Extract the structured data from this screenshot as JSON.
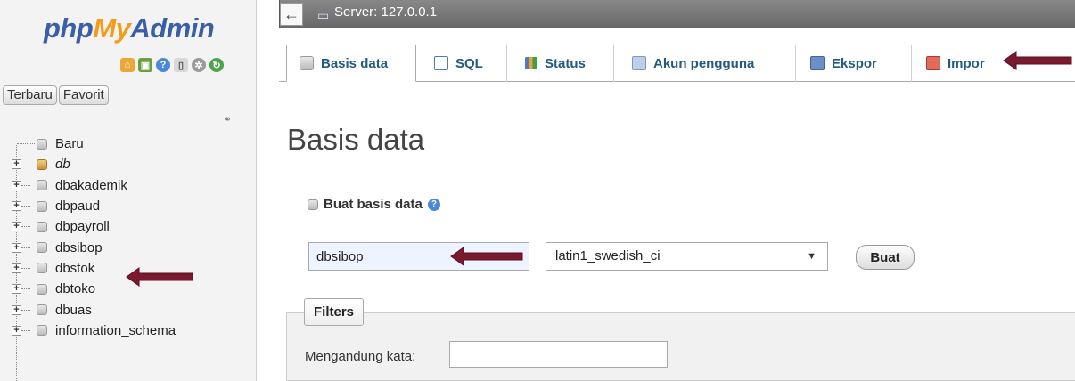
{
  "app": {
    "logo_part1": "php",
    "logo_part2": "My",
    "logo_part3": "Admin"
  },
  "sidebar": {
    "tabs": [
      "Terbaru",
      "Favorit"
    ],
    "toolbar_icons": [
      "home-icon",
      "exit-icon",
      "help-icon",
      "docs-icon",
      "settings-icon",
      "reload-icon"
    ],
    "tree": [
      {
        "label": "Baru",
        "icon": "new-db-icon",
        "expandable": false,
        "italic": false
      },
      {
        "label": "db",
        "icon": "db-group-icon",
        "expandable": true,
        "italic": true
      },
      {
        "label": "dbakademik",
        "icon": "database-icon",
        "expandable": true,
        "italic": false
      },
      {
        "label": "dbpaud",
        "icon": "database-icon",
        "expandable": true,
        "italic": false
      },
      {
        "label": "dbpayroll",
        "icon": "database-icon",
        "expandable": true,
        "italic": false
      },
      {
        "label": "dbsibop",
        "icon": "database-icon",
        "expandable": true,
        "italic": false
      },
      {
        "label": "dbstok",
        "icon": "database-icon",
        "expandable": true,
        "italic": false
      },
      {
        "label": "dbtoko",
        "icon": "database-icon",
        "expandable": true,
        "italic": false
      },
      {
        "label": "dbuas",
        "icon": "database-icon",
        "expandable": true,
        "italic": false
      },
      {
        "label": "information_schema",
        "icon": "database-icon",
        "expandable": true,
        "italic": false
      }
    ]
  },
  "topbar": {
    "server_label": "Server: 127.0.0.1"
  },
  "tabs": [
    {
      "label": "Basis data",
      "icon": "database-icon",
      "active": true
    },
    {
      "label": "SQL",
      "icon": "sql-icon",
      "active": false
    },
    {
      "label": "Status",
      "icon": "status-icon",
      "active": false
    },
    {
      "label": "Akun pengguna",
      "icon": "users-icon",
      "active": false
    },
    {
      "label": "Ekspor",
      "icon": "export-icon",
      "active": false
    },
    {
      "label": "Impor",
      "icon": "import-icon",
      "active": false
    }
  ],
  "main": {
    "page_title": "Basis data",
    "create_heading": "Buat basis data",
    "db_name_value": "dbsibop",
    "collation_value": "latin1_swedish_ci",
    "create_button": "Buat",
    "filters_legend": "Filters",
    "filter_label": "Mengandung kata:",
    "filter_value": ""
  },
  "colors": {
    "logo_blue": "#3a5fa8",
    "logo_orange": "#f59b18",
    "tab_text": "#235a81",
    "annotation_arrow": "#7b1a2e"
  }
}
